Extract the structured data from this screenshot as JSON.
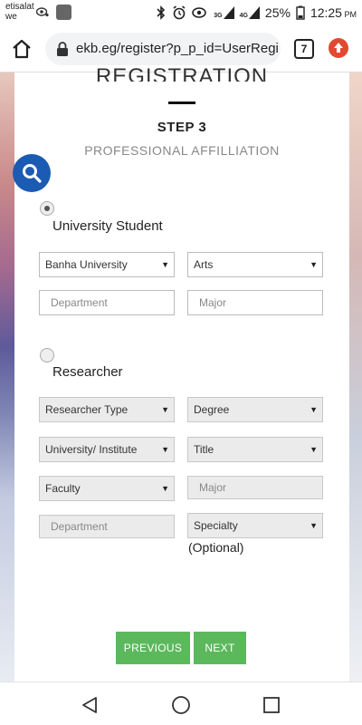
{
  "status_bar": {
    "carrier_line1": "etisalat",
    "carrier_line2": "we",
    "net_top": "3G",
    "net_bottom": "4G",
    "battery": "25%",
    "time": "12:25",
    "ampm": "PM"
  },
  "browser": {
    "url": "ekb.eg/register?p_p_id=UserRegistrat",
    "tab_count": "7"
  },
  "form": {
    "title": "REGISTRATION",
    "step": "STEP 3",
    "step_subtitle": "PROFESSIONAL AFFILLIATION",
    "student_section": {
      "label": "University Student",
      "selected": true,
      "university": "Banha University",
      "faculty": "Arts",
      "department_placeholder": "Department",
      "major_placeholder": "Major"
    },
    "researcher_section": {
      "label": "Researcher",
      "selected": false,
      "researcher_type": "Researcher Type",
      "degree": "Degree",
      "institute": "University/ Institute",
      "title_field": "Title",
      "faculty": "Faculty",
      "major_placeholder": "Major",
      "department_placeholder": "Department",
      "specialty": "Specialty",
      "optional_note": "(Optional)"
    },
    "buttons": {
      "previous": "PREVIOUS",
      "next": "NEXT"
    }
  },
  "colors": {
    "accent_green": "#5cb85c",
    "fab_blue": "#1c5bb3",
    "update_red": "#e04a30"
  }
}
